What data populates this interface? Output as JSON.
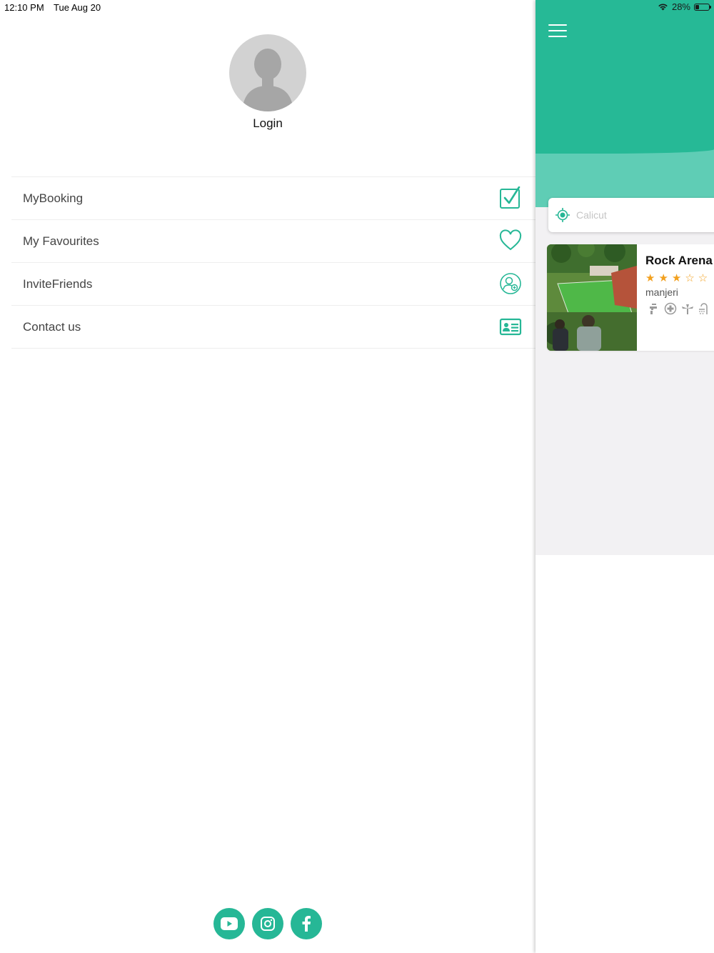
{
  "status_bar": {
    "time": "12:10 PM",
    "date": "Tue Aug 20",
    "battery": "28%"
  },
  "drawer": {
    "login_label": "Login",
    "menu": [
      {
        "label": "MyBooking",
        "icon": "check-box-icon"
      },
      {
        "label": "My Favourites",
        "icon": "heart-icon"
      },
      {
        "label": "InviteFriends",
        "icon": "add-user-icon"
      },
      {
        "label": "Contact us",
        "icon": "contact-card-icon"
      }
    ],
    "social": [
      "youtube-icon",
      "instagram-icon",
      "facebook-icon"
    ]
  },
  "main": {
    "search": {
      "placeholder": "Calicut",
      "value": ""
    },
    "venues": [
      {
        "name": "Rock Arena",
        "rating": "3 of 5",
        "stars": "★★★☆☆",
        "location": "manjeri"
      }
    ]
  },
  "colors": {
    "accent": "#26b996",
    "accent_light": "#5fcdb5",
    "star": "#f2a01e"
  }
}
